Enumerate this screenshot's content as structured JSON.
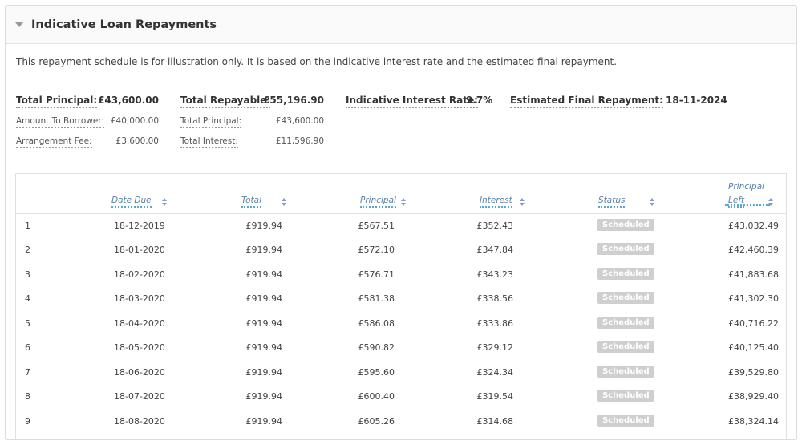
{
  "panel": {
    "title": "Indicative Loan Repayments",
    "intro": "This repayment schedule is for illustration only. It is based on the indicative interest rate and the estimated final repayment."
  },
  "summary": {
    "total_principal_label": "Total Principal:",
    "total_principal_value": "£43,600.00",
    "amount_to_borrower_label": "Amount To Borrower:",
    "amount_to_borrower_value": "£40,000.00",
    "arrangement_fee_label": "Arrangement Fee:",
    "arrangement_fee_value": "£3,600.00",
    "total_repayable_label": "Total Repayable:",
    "total_repayable_value": "£55,196.90",
    "repayable_principal_label": "Total Principal:",
    "repayable_principal_value": "£43,600.00",
    "total_interest_label": "Total Interest:",
    "total_interest_value": "£11,596.90",
    "interest_rate_label": "Indicative Interest Rate:",
    "interest_rate_value": "9.7%",
    "final_repayment_label": "Estimated Final Repayment:",
    "final_repayment_value": "18-11-2024"
  },
  "table": {
    "headers": {
      "date_due": "Date Due",
      "total": "Total",
      "principal": "Principal",
      "interest": "Interest",
      "status": "Status",
      "principal_left_1": "Principal",
      "principal_left_2": "Left"
    },
    "rows": [
      {
        "num": "1",
        "date": "18-12-2019",
        "total": "£919.94",
        "principal": "£567.51",
        "interest": "£352.43",
        "status": "Scheduled",
        "left": "£43,032.49"
      },
      {
        "num": "2",
        "date": "18-01-2020",
        "total": "£919.94",
        "principal": "£572.10",
        "interest": "£347.84",
        "status": "Scheduled",
        "left": "£42,460.39"
      },
      {
        "num": "3",
        "date": "18-02-2020",
        "total": "£919.94",
        "principal": "£576.71",
        "interest": "£343.23",
        "status": "Scheduled",
        "left": "£41,883.68"
      },
      {
        "num": "4",
        "date": "18-03-2020",
        "total": "£919.94",
        "principal": "£581.38",
        "interest": "£338.56",
        "status": "Scheduled",
        "left": "£41,302.30"
      },
      {
        "num": "5",
        "date": "18-04-2020",
        "total": "£919.94",
        "principal": "£586.08",
        "interest": "£333.86",
        "status": "Scheduled",
        "left": "£40,716.22"
      },
      {
        "num": "6",
        "date": "18-05-2020",
        "total": "£919.94",
        "principal": "£590.82",
        "interest": "£329.12",
        "status": "Scheduled",
        "left": "£40,125.40"
      },
      {
        "num": "7",
        "date": "18-06-2020",
        "total": "£919.94",
        "principal": "£595.60",
        "interest": "£324.34",
        "status": "Scheduled",
        "left": "£39,529.80"
      },
      {
        "num": "8",
        "date": "18-07-2020",
        "total": "£919.94",
        "principal": "£600.40",
        "interest": "£319.54",
        "status": "Scheduled",
        "left": "£38,929.40"
      },
      {
        "num": "9",
        "date": "18-08-2020",
        "total": "£919.94",
        "principal": "£605.26",
        "interest": "£314.68",
        "status": "Scheduled",
        "left": "£38,324.14"
      }
    ]
  },
  "colors": {
    "accent_dotted": "#5aa7d6",
    "header_text": "#5a7fa8",
    "badge_bg": "#cfcfcf"
  },
  "icons": {
    "collapse": "caret-down-icon",
    "sort": "sort-icon"
  }
}
